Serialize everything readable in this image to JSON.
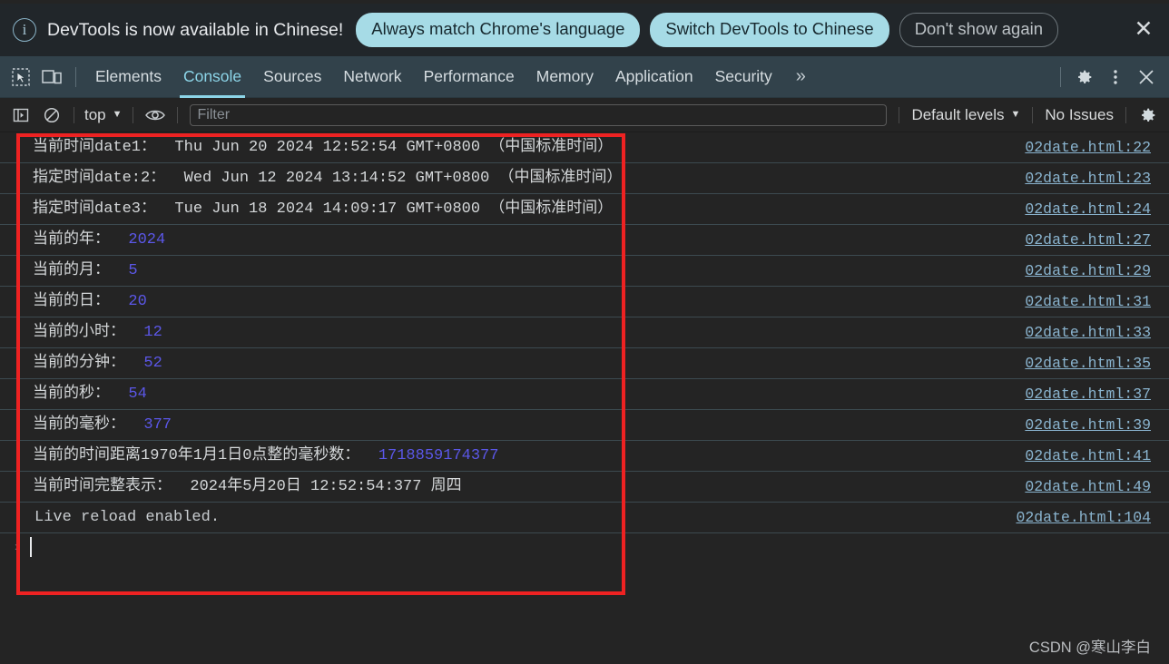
{
  "banner": {
    "icon": "info-circle-icon",
    "message": "DevTools is now available in Chinese!",
    "primary_button": "Always match Chrome's language",
    "secondary_button": "Switch DevTools to Chinese",
    "dismiss_button": "Don't show again",
    "close_icon": "close-icon",
    "accent_color": "#a6dbe6"
  },
  "tabbar": {
    "inspect_icon": "inspect-element-icon",
    "device_icon": "device-toolbar-icon",
    "tabs": [
      {
        "label": "Elements",
        "active": false
      },
      {
        "label": "Console",
        "active": true
      },
      {
        "label": "Sources",
        "active": false
      },
      {
        "label": "Network",
        "active": false
      },
      {
        "label": "Performance",
        "active": false
      },
      {
        "label": "Memory",
        "active": false
      },
      {
        "label": "Application",
        "active": false
      },
      {
        "label": "Security",
        "active": false
      }
    ],
    "more_tabs": "»",
    "settings_icon": "gear-icon",
    "menu_icon": "kebab-menu-icon",
    "close_icon": "close-icon",
    "active_color": "#8cd5e8"
  },
  "console_toolbar": {
    "sidebar_icon": "console-sidebar-icon",
    "clear_icon": "clear-console-icon",
    "context": "top",
    "context_caret": "▼",
    "eye_icon": "live-expression-eye-icon",
    "filter_placeholder": "Filter",
    "filter_value": "",
    "levels": "Default levels",
    "levels_caret": "▼",
    "issues": "No Issues",
    "settings_icon": "console-settings-gear-icon"
  },
  "console_rows": [
    {
      "prefix": "当前时间date1：  Thu Jun 20 2024 12:52:54 GMT+0800 （中国标准时间）",
      "value": "",
      "link": "02date.html:22"
    },
    {
      "prefix": "指定时间date:2：  Wed Jun 12 2024 13:14:52 GMT+0800 （中国标准时间）",
      "value": "",
      "link": "02date.html:23"
    },
    {
      "prefix": "指定时间date3：  Tue Jun 18 2024 14:09:17 GMT+0800 （中国标准时间）",
      "value": "",
      "link": "02date.html:24"
    },
    {
      "prefix": "当前的年：  ",
      "value": "2024",
      "link": "02date.html:27"
    },
    {
      "prefix": "当前的月：  ",
      "value": "5",
      "link": "02date.html:29"
    },
    {
      "prefix": "当前的日：  ",
      "value": "20",
      "link": "02date.html:31"
    },
    {
      "prefix": "当前的小时：  ",
      "value": "12",
      "link": "02date.html:33"
    },
    {
      "prefix": "当前的分钟：  ",
      "value": "52",
      "link": "02date.html:35"
    },
    {
      "prefix": "当前的秒：  ",
      "value": "54",
      "link": "02date.html:37"
    },
    {
      "prefix": "当前的毫秒：  ",
      "value": "377",
      "link": "02date.html:39"
    },
    {
      "prefix": "当前的时间距离1970年1月1日0点整的毫秒数：  ",
      "value": "1718859174377",
      "link": "02date.html:41"
    },
    {
      "prefix": "当前时间完整表示：  2024年5月20日 12:52:54:377 周四",
      "value": "",
      "link": "02date.html:49"
    },
    {
      "prefix": "Live reload enabled.",
      "value": "",
      "link": "02date.html:104"
    }
  ],
  "prompt": {
    "chevron": "›",
    "value": ""
  },
  "annotation": {
    "type": "red-rectangle",
    "color": "#ee2222"
  },
  "watermark": "CSDN @寒山李白"
}
